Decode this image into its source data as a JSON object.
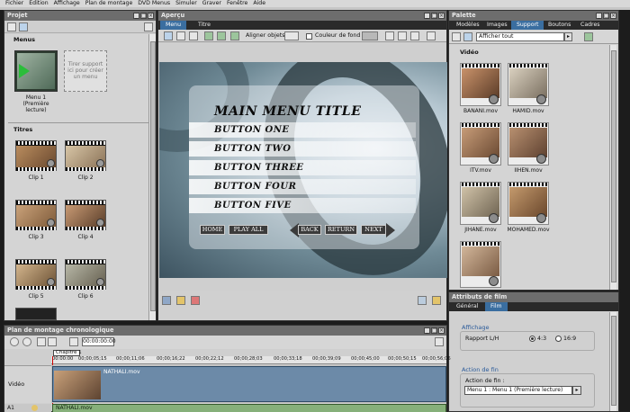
{
  "menubar": [
    "Fichier",
    "Edition",
    "Affichage",
    "Plan de montage",
    "DVD Menus",
    "Simuler",
    "Graver",
    "Fenêtre",
    "Aide"
  ],
  "projet": {
    "title": "Projet",
    "section_menus": "Menus",
    "menus": [
      {
        "label": "Menu 1 (Première lecture)"
      },
      {
        "label": "Tirer support ici pour créer un menu"
      }
    ],
    "section_titres": "Titres",
    "titres": [
      "Clip 1",
      "Clip 2",
      "Clip 3",
      "Clip 4",
      "Clip 5",
      "Clip 6"
    ]
  },
  "apercu": {
    "title": "Aperçu",
    "tabs": [
      "Menu",
      "Titre"
    ],
    "toolbar_align": "Aligner objets",
    "toolbar_bg": "Couleur de fond",
    "menu_title": "MAIN MENU TITLE",
    "buttons": [
      "BUTTON ONE",
      "BUTTON TWO",
      "BUTTON THREE",
      "BUTTON FOUR",
      "BUTTON FIVE"
    ],
    "nav": [
      "HOME",
      "PLAY ALL",
      "BACK",
      "RETURN",
      "NEXT"
    ]
  },
  "palette": {
    "title": "Palette",
    "tabs": [
      "Modèles",
      "Images",
      "Support",
      "Boutons",
      "Cadres"
    ],
    "active_tab": "Support",
    "filter_value": "Afficher tout",
    "section": "Vidéo",
    "items": [
      "BANANI.mov",
      "HAMID.mov",
      "ITV.mov",
      "IIHEN.mov",
      "JIHANE.mov",
      "MOHAMED.mov",
      ""
    ]
  },
  "attributs": {
    "title": "Attributs de film",
    "tabs": [
      "Général",
      "Film"
    ],
    "affichage_label": "Affichage",
    "ratio_label": "Rapport L/H",
    "ratio_options": [
      "4:3",
      "16:9"
    ],
    "fin_section": "Action de fin",
    "fin_label": "Action de fin :",
    "fin_value": "Menu 1 : Menu 1 (Première lecture)"
  },
  "timeline": {
    "title": "Plan de montage chronologique",
    "timecode": "00:00:00:00",
    "chapter_label": "Chapitre 1",
    "ruler": [
      "00:00:00",
      "00;00;05;15",
      "00;00;11;06",
      "00;00;16;22",
      "00;00;22;12",
      "00;00;28;03",
      "00;00;33;18",
      "00;00;39;09",
      "00;00;45;00",
      "00;00;50;15",
      "00;00;56;06"
    ],
    "track_video": "Vidéo",
    "clip_name": "NATHALI.mov",
    "track_audio_label": "A1",
    "audio_clip": "NATHALI.mov"
  }
}
